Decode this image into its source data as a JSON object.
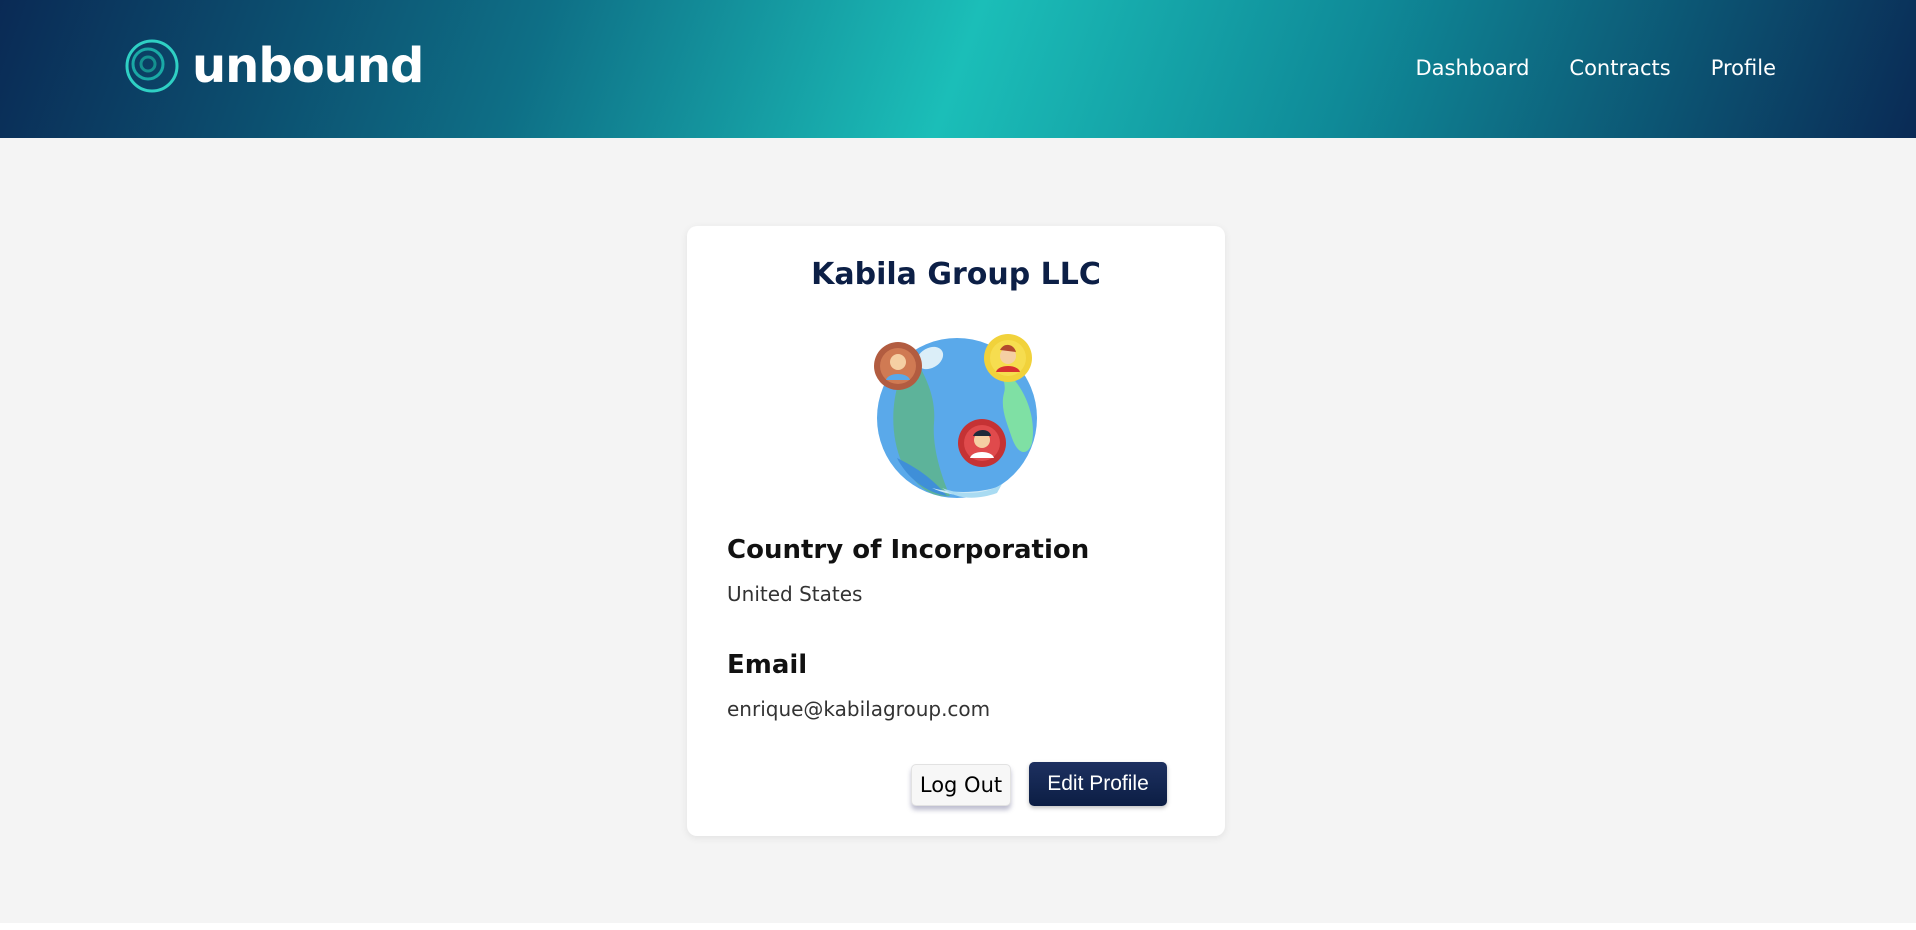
{
  "header": {
    "logo_text": "unbound",
    "nav": [
      {
        "label": "Dashboard"
      },
      {
        "label": "Contracts"
      },
      {
        "label": "Profile"
      }
    ]
  },
  "profile": {
    "company_name": "Kabila Group LLC",
    "avatar_icon": "globe-with-people-icon",
    "fields": [
      {
        "label": "Country of Incorporation",
        "value": "United States"
      },
      {
        "label": "Email",
        "value": "enrique@kabilagroup.com"
      }
    ],
    "buttons": {
      "logout": "Log Out",
      "edit": "Edit Profile"
    }
  },
  "colors": {
    "brand_navy": "#0c1f46",
    "brand_teal": "#1bbeb8",
    "page_bg": "#f4f4f4"
  }
}
